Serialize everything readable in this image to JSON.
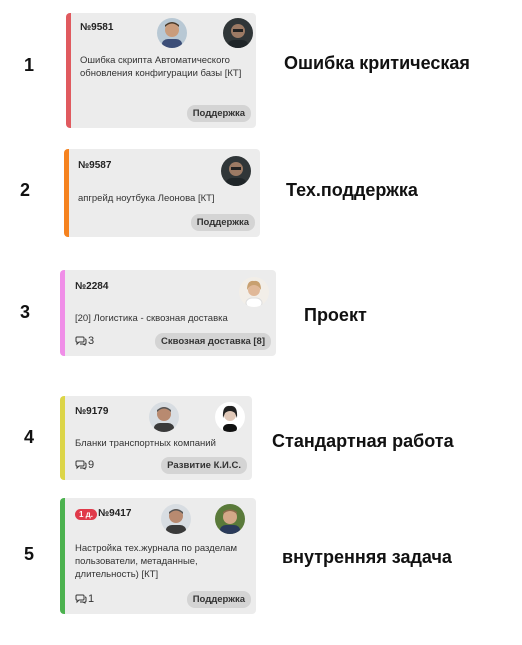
{
  "rows": [
    {
      "num": "1",
      "type": "Ошибка критическая",
      "card": {
        "id": "№9581",
        "title": "Ошибка скрипта Автоматического обновления конфигурации базы [КТ]",
        "tag": "Поддержка",
        "color": "#e05a5f"
      }
    },
    {
      "num": "2",
      "type": "Тех.поддержка",
      "card": {
        "id": "№9587",
        "title": "апгрейд ноутбука Леонова [КТ]",
        "tag": "Поддержка",
        "color": "#f5821f"
      }
    },
    {
      "num": "3",
      "type": "Проект",
      "card": {
        "id": "№2284",
        "title": "[20] Логистика - сквозная доставка",
        "tag": "Сквозная доставка [8]",
        "comments": "3",
        "color": "#f08ee8"
      }
    },
    {
      "num": "4",
      "type": "Стандартная работа",
      "card": {
        "id": "№9179",
        "title": "Бланки транспортных компаний",
        "tag": "Развитие К.И.С.",
        "comments": "9",
        "color": "#dcd548"
      }
    },
    {
      "num": "5",
      "type": "внутренняя задача",
      "card": {
        "id": "№9417",
        "badge": "1 д.",
        "title": "Настройка тех.журнала по разделам пользователи, метаданные, длительность) [КТ]",
        "tag": "Поддержка",
        "comments": "1",
        "color": "#4cb24f"
      }
    }
  ]
}
